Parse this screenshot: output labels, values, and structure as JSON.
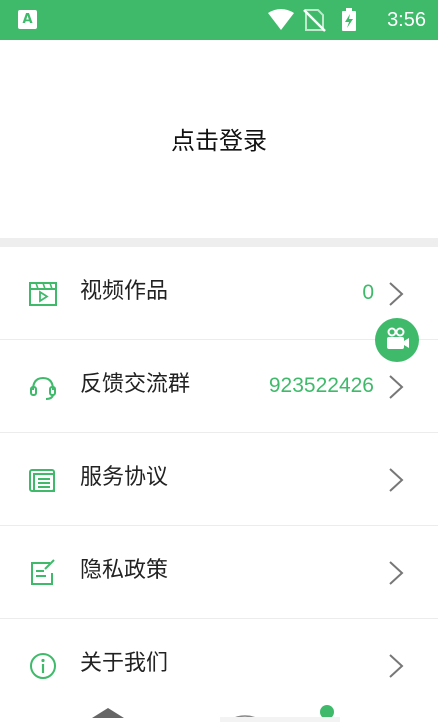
{
  "status_bar": {
    "app_icon_letter": "A",
    "time": "3:56",
    "background": "#3fba6b"
  },
  "login": {
    "label": "点击登录"
  },
  "menu": [
    {
      "label": "视频作品",
      "value": "0",
      "icon": "video-icon"
    },
    {
      "label": "反馈交流群",
      "value": "923522426",
      "icon": "headset-icon"
    },
    {
      "label": "服务协议",
      "value": "",
      "icon": "document-icon"
    },
    {
      "label": "隐私政策",
      "value": "",
      "icon": "edit-document-icon"
    },
    {
      "label": "关于我们",
      "value": "",
      "icon": "info-icon"
    }
  ],
  "accent_color": "#3fba6b"
}
